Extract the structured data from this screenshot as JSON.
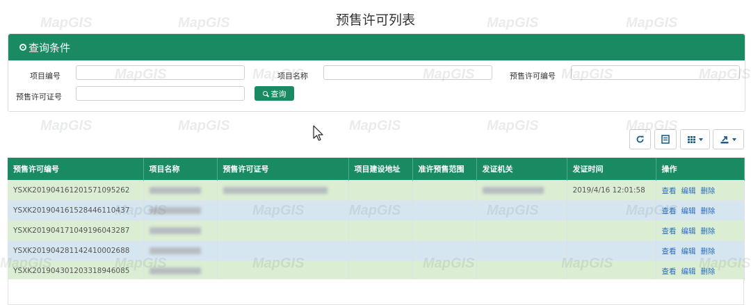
{
  "page": {
    "title": "预售许可列表"
  },
  "watermark": {
    "text": "MapGIS"
  },
  "query": {
    "header": "查询条件",
    "fields": [
      {
        "label": "项目编号",
        "value": "",
        "placeholder": ""
      },
      {
        "label": "项目名称",
        "value": "",
        "placeholder": ""
      },
      {
        "label": "预售许可编号",
        "value": "",
        "placeholder": ""
      },
      {
        "label": "预售许可证号",
        "value": "",
        "placeholder": ""
      }
    ],
    "search_label": "查询"
  },
  "toolbar": {
    "buttons": [
      {
        "icon": "refresh-icon"
      },
      {
        "icon": "toggle-view-icon"
      },
      {
        "icon": "columns-icon",
        "dropdown": true
      },
      {
        "icon": "export-icon",
        "dropdown": true
      }
    ]
  },
  "table": {
    "columns": [
      "预售许可编号",
      "项目名称",
      "预售许可证号",
      "项目建设地址",
      "准许预售范围",
      "发证机关",
      "发证时间",
      "操作"
    ],
    "actions": [
      "查看",
      "编辑",
      "删除"
    ],
    "rows": [
      {
        "id": "YSXK20190416120157109526​2",
        "time": "2019/4/16 12:01:58"
      },
      {
        "id": "YSXK20190416152844611043​7",
        "time": ""
      },
      {
        "id": "YSXK20190417104919604328​7",
        "time": ""
      },
      {
        "id": "YSXK20190428114241000268​8",
        "time": ""
      },
      {
        "id": "YSXK20190430120331894608​5",
        "time": ""
      }
    ]
  },
  "colors": {
    "accent": "#1a8a63",
    "row_green": "#dbeed3",
    "row_blue": "#d6e6f1",
    "link": "#2a6dbb"
  }
}
